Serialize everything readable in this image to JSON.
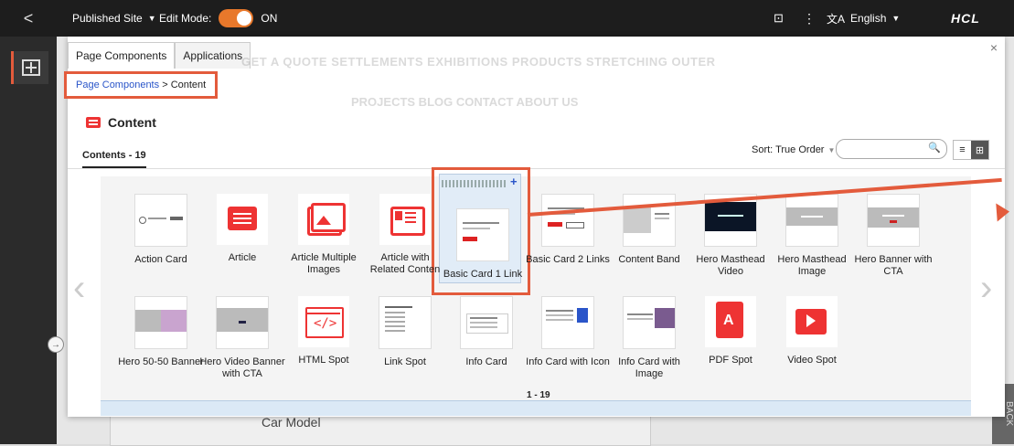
{
  "topbar": {
    "back_label": "<",
    "site_label": "Published Site",
    "edit_mode_label": "Edit Mode:",
    "edit_mode_state": "ON",
    "language": "English",
    "brand": "HCL"
  },
  "panel": {
    "tabs": [
      "Page Components",
      "Applications"
    ],
    "breadcrumb_link": "Page Components",
    "breadcrumb_sep": ">",
    "breadcrumb_current": "Content",
    "title": "Content",
    "count_label": "Contents - 19",
    "sort_label": "Sort: True Order",
    "search_placeholder": "",
    "pagination": "1 - 19",
    "ghost_nav_row1": "GET A QUOTE   SETTLEMENTS   EXHIBITIONS   PRODUCTS   STRETCHING OUTER",
    "ghost_nav_row2": "PROJECTS   BLOG   CONTACT   ABOUT US",
    "tiles_row1": [
      "Action Card",
      "Article",
      "Article Multiple Images",
      "Article with Related Conten",
      "Basic Card 1 Link",
      "Basic Card 2 Links",
      "Content Band",
      "Hero Masthead Video",
      "Hero Masthead Image",
      "Hero Banner with CTA"
    ],
    "tiles_row2": [
      "Hero 50-50 Banner",
      "Hero Video Banner with CTA",
      "HTML Spot",
      "Link Spot",
      "Info Card",
      "Info Card with Icon",
      "Info Card with Image",
      "PDF Spot",
      "Video Spot"
    ]
  },
  "background": {
    "car_model_label": "Car Model",
    "back_tab": "BACK"
  },
  "colors": {
    "accent": "#e35b3c",
    "toggle": "#e8782b",
    "selected_bg": "#e1ecf7",
    "link": "#2a55c9"
  }
}
